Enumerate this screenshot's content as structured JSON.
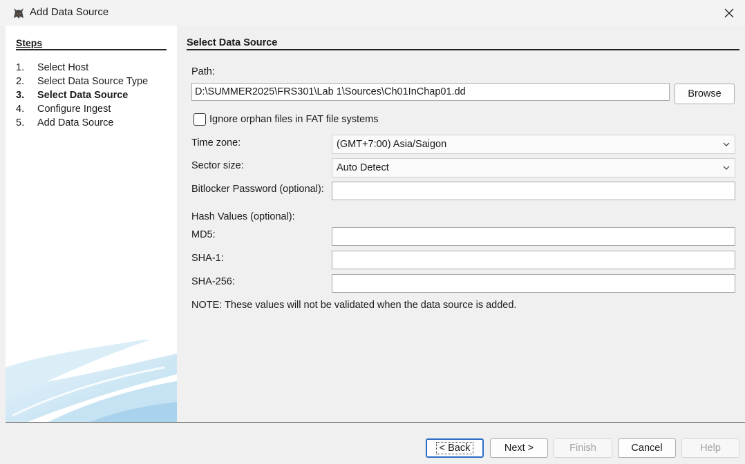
{
  "window": {
    "title": "Add Data Source",
    "app_icon": "autopsy-dog-icon",
    "close_icon": "close-icon"
  },
  "steps": {
    "title": "Steps",
    "items": [
      {
        "num": "1.",
        "label": "Select Host"
      },
      {
        "num": "2.",
        "label": "Select Data Source Type"
      },
      {
        "num": "3.",
        "label": "Select Data Source",
        "active": true
      },
      {
        "num": "4.",
        "label": "Configure Ingest"
      },
      {
        "num": "5.",
        "label": "Add Data Source"
      }
    ]
  },
  "panel": {
    "title": "Select Data Source",
    "path_label": "Path:",
    "path_value": "D:\\SUMMER2025\\FRS301\\Lab 1\\Sources\\Ch01InChap01.dd",
    "browse_label": "Browse",
    "ignore_orphan_label": "Ignore orphan files in FAT file systems",
    "ignore_orphan_checked": false,
    "timezone_label": "Time zone:",
    "timezone_value": "(GMT+7:00) Asia/Saigon",
    "sector_label": "Sector size:",
    "sector_value": "Auto Detect",
    "bitlocker_label": "Bitlocker Password (optional):",
    "bitlocker_value": "",
    "hash_label": "Hash Values (optional):",
    "md5_label": "MD5:",
    "md5_value": "",
    "sha1_label": "SHA-1:",
    "sha1_value": "",
    "sha256_label": "SHA-256:",
    "sha256_value": "",
    "note": "NOTE: These values will not be validated when the data source is added."
  },
  "footer": {
    "back_label": "< Back",
    "next_label": "Next >",
    "finish_label": "Finish",
    "cancel_label": "Cancel",
    "help_label": "Help"
  }
}
